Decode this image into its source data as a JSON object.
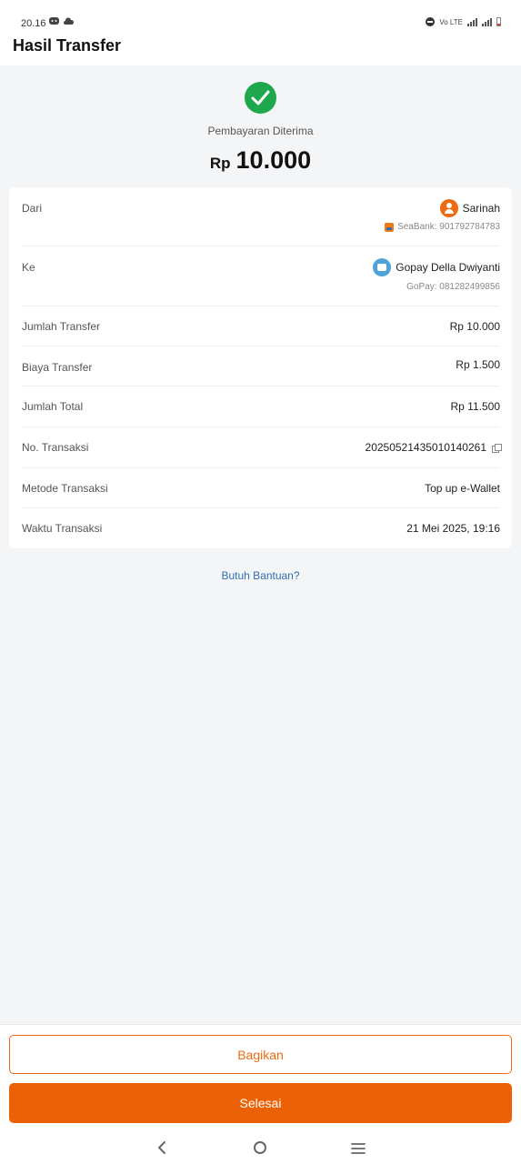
{
  "status_bar": {
    "time": "20.16",
    "left_icons": [
      "discord-icon",
      "cloud-icon"
    ],
    "network_label": "Vo LTE"
  },
  "header": {
    "title": "Hasil Transfer"
  },
  "success": {
    "icon": "check-circle-icon",
    "color": "#1fa74d",
    "label": "Pembayaran Diterima",
    "currency": "Rp",
    "amount": "10.000"
  },
  "details": {
    "from_label": "Dari",
    "from_name": "Sarinah",
    "from_account": "SeaBank: 901792784783",
    "to_label": "Ke",
    "to_name": "Gopay Della Dwiyanti",
    "to_account": "GoPay: 081282499856",
    "rows": [
      {
        "label": "Jumlah Transfer",
        "value": "Rp 10.000"
      },
      {
        "label": "Biaya Transfer",
        "value": "Rp 1.500"
      },
      {
        "label": "Jumlah Total",
        "value": "Rp 11.500"
      },
      {
        "label": "No. Transaksi",
        "value": "20250521435010140261"
      },
      {
        "label": "Metode Transaksi",
        "value": "Top up e-Wallet"
      },
      {
        "label": "Waktu Transaksi",
        "value": "21 Mei 2025, 19:16"
      }
    ]
  },
  "help_link": "Butuh Bantuan?",
  "buttons": {
    "share": "Bagikan",
    "done": "Selesai"
  },
  "colors": {
    "accent": "#ec6106",
    "link": "#2f6fb5",
    "success": "#1fa74d"
  }
}
